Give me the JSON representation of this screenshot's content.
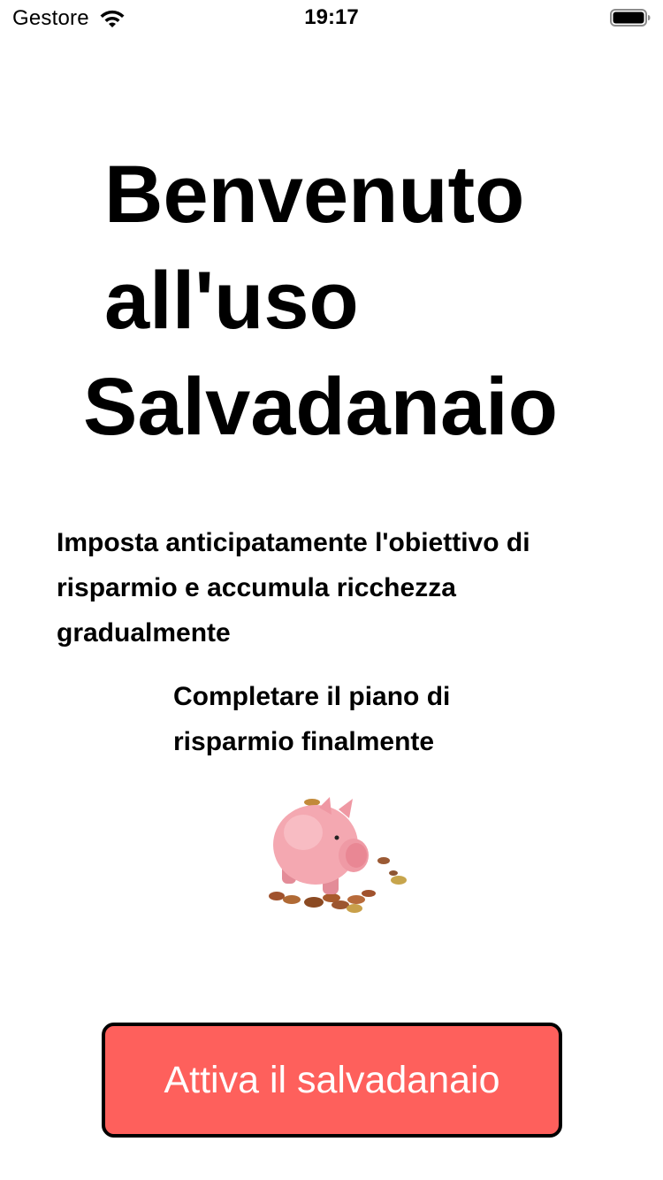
{
  "status_bar": {
    "carrier": "Gestore",
    "time": "19:17",
    "wifi_icon": "wifi-icon",
    "battery_icon": "battery-icon"
  },
  "headline": {
    "line1": "Benvenuto",
    "line2": "all'uso",
    "line3": "Salvadanaio"
  },
  "subtitle": "Imposta anticipatamente l'obiettivo di risparmio e accumula ricchezza gradualmente",
  "caption": {
    "line1": "Completare il piano di",
    "line2": "risparmio finalmente"
  },
  "illustration_icon": "piggy-bank-icon",
  "cta": {
    "label": "Attiva il salvadanaio",
    "color": "#fe605c"
  }
}
